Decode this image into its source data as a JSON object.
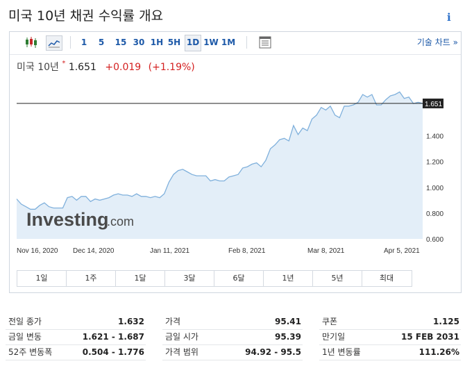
{
  "header": {
    "title": "미국 10년 채권 수익률 개요",
    "info_icon": "info-icon"
  },
  "toolbar": {
    "icons": [
      "candlestick-icon",
      "line-chart-icon",
      "settings-sheet-icon"
    ],
    "intervals": [
      "1",
      "5",
      "15",
      "30",
      "1H",
      "5H",
      "1D",
      "1W",
      "1M"
    ],
    "active_interval": "1D",
    "advanced_label": "기술 차트 »"
  },
  "quote": {
    "name": "미국 10년",
    "dot": "*",
    "price": "1.651",
    "change": "+0.019",
    "change_pct": "(+1.19%)",
    "change_color": "#d42020"
  },
  "chart_data": {
    "type": "area",
    "x_labels": [
      "Nov 16, 2020",
      "Dec 14, 2020",
      "Jan 11, 2021",
      "Feb 8, 2021",
      "Mar 8, 2021",
      "Apr 5, 2021"
    ],
    "y_ticks": [
      "0.600",
      "0.800",
      "1.000",
      "1.200",
      "1.400"
    ],
    "ylim": [
      0.6,
      1.85
    ],
    "current_label": "1.651",
    "current_value": 1.651,
    "watermark": "Investing",
    "watermark_suffix": ".com",
    "line_color": "#7fb0dc",
    "fill_color": "#e3eef8",
    "values": [
      0.91,
      0.87,
      0.85,
      0.83,
      0.83,
      0.86,
      0.88,
      0.85,
      0.84,
      0.84,
      0.84,
      0.92,
      0.93,
      0.9,
      0.93,
      0.93,
      0.89,
      0.91,
      0.9,
      0.91,
      0.92,
      0.94,
      0.95,
      0.94,
      0.94,
      0.93,
      0.95,
      0.93,
      0.93,
      0.92,
      0.93,
      0.92,
      0.95,
      1.04,
      1.1,
      1.13,
      1.14,
      1.12,
      1.1,
      1.09,
      1.09,
      1.09,
      1.05,
      1.06,
      1.05,
      1.05,
      1.08,
      1.09,
      1.1,
      1.15,
      1.16,
      1.18,
      1.19,
      1.16,
      1.21,
      1.3,
      1.33,
      1.37,
      1.38,
      1.36,
      1.48,
      1.41,
      1.46,
      1.44,
      1.53,
      1.56,
      1.62,
      1.6,
      1.63,
      1.56,
      1.54,
      1.63,
      1.63,
      1.64,
      1.66,
      1.72,
      1.7,
      1.72,
      1.64,
      1.64,
      1.68,
      1.71,
      1.72,
      1.74,
      1.69,
      1.7,
      1.65,
      1.66,
      1.651
    ]
  },
  "ranges": [
    "1일",
    "1주",
    "1달",
    "3달",
    "6달",
    "1년",
    "5년",
    "최대"
  ],
  "stats": {
    "col1": [
      {
        "label": "전일 종가",
        "value": "1.632"
      },
      {
        "label": "금일 변동",
        "value": "1.621 - 1.687"
      },
      {
        "label": "52주 변동폭",
        "value": "0.504 - 1.776"
      }
    ],
    "col2": [
      {
        "label": "가격",
        "value": "95.41"
      },
      {
        "label": "금일 시가",
        "value": "95.39"
      },
      {
        "label": "가격 범위",
        "value": "94.92 - 95.5"
      }
    ],
    "col3": [
      {
        "label": "쿠폰",
        "value": "1.125"
      },
      {
        "label": "만기일",
        "value": "15 FEB 2031"
      },
      {
        "label": "1년 변동률",
        "value": "111.26%"
      }
    ]
  }
}
